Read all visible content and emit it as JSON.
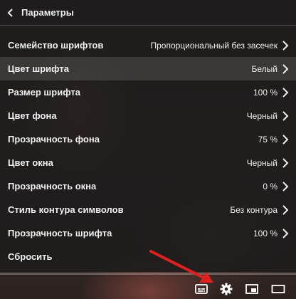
{
  "header": {
    "title": "Параметры"
  },
  "settings": [
    {
      "label": "Семейство шрифтов",
      "value": "Пропорциональный без засечек"
    },
    {
      "label": "Цвет шрифта",
      "value": "Белый"
    },
    {
      "label": "Размер шрифта",
      "value": "100 %"
    },
    {
      "label": "Цвет фона",
      "value": "Черный"
    },
    {
      "label": "Прозрачность фона",
      "value": "75 %"
    },
    {
      "label": "Цвет окна",
      "value": "Черный"
    },
    {
      "label": "Прозрачность окна",
      "value": "0 %"
    },
    {
      "label": "Стиль контура символов",
      "value": "Без контура"
    },
    {
      "label": "Прозрачность шрифта",
      "value": "100 %"
    },
    {
      "label": "Сбросить",
      "value": ""
    }
  ],
  "highlighted_row": "Цвет шрифта",
  "controls": [
    "subtitles-icon",
    "gear-icon",
    "miniplayer-icon",
    "theater-mode-icon"
  ],
  "colors": {
    "panel_text": "#eeeeee",
    "annotation_arrow": "#e0201c"
  }
}
